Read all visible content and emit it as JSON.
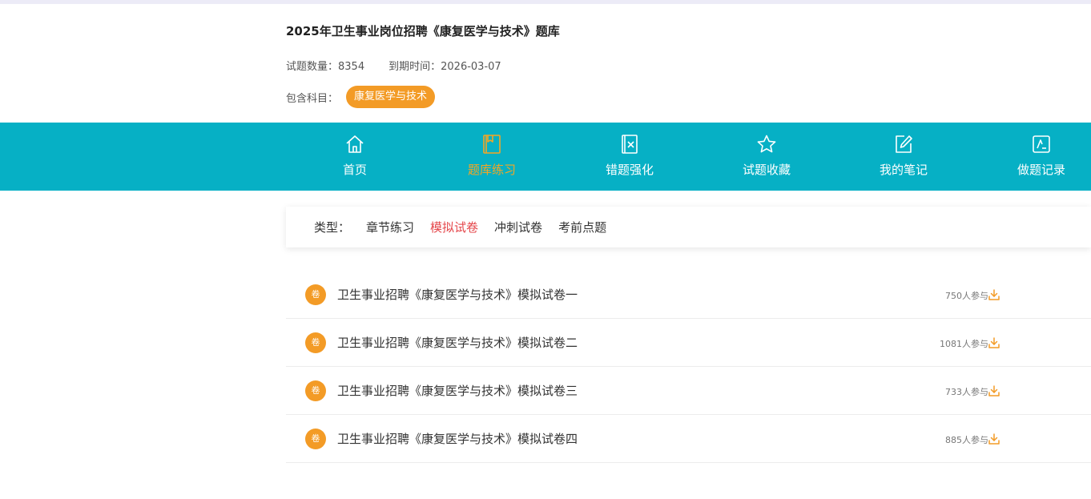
{
  "info": {
    "title": "2025年卫生事业岗位招聘《康复医学与技术》题库",
    "question_count_label": "试题数量：",
    "question_count": "8354",
    "expiry_label": "到期时间：",
    "expiry_date": "2026-03-07",
    "subjects_label": "包含科目：",
    "subject": "康复医学与技术"
  },
  "nav": {
    "items": [
      {
        "label": "首页",
        "icon": "home-icon"
      },
      {
        "label": "题库练习",
        "icon": "book-icon",
        "active": true
      },
      {
        "label": "错题强化",
        "icon": "wrong-question-icon"
      },
      {
        "label": "试题收藏",
        "icon": "star-icon"
      },
      {
        "label": "我的笔记",
        "icon": "note-edit-icon"
      },
      {
        "label": "做题记录",
        "icon": "record-icon"
      }
    ]
  },
  "types": {
    "label": "类型：",
    "options": [
      {
        "label": "章节练习"
      },
      {
        "label": "模拟试卷",
        "active": true
      },
      {
        "label": "冲刺试卷"
      },
      {
        "label": "考前点题"
      }
    ]
  },
  "papers": {
    "badge": "卷",
    "items": [
      {
        "title": "卫生事业招聘《康复医学与技术》模拟试卷一",
        "participants": "750人参与"
      },
      {
        "title": "卫生事业招聘《康复医学与技术》模拟试卷二",
        "participants": "1081人参与"
      },
      {
        "title": "卫生事业招聘《康复医学与技术》模拟试卷三",
        "participants": "733人参与"
      },
      {
        "title": "卫生事业招聘《康复医学与技术》模拟试卷四",
        "participants": "885人参与"
      }
    ],
    "download_icon": "download-icon"
  },
  "colors": {
    "nav_background": "#06b0c5",
    "accent_orange": "#f39b26",
    "active_nav_text": "#f5a623",
    "active_type_text": "#e5474b"
  }
}
